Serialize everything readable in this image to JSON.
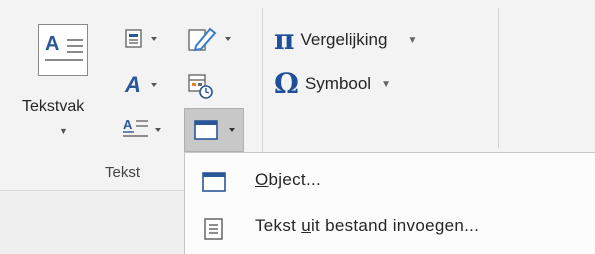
{
  "text_group": {
    "textbox_label": "Tekstvak",
    "group_label": "Tekst"
  },
  "symbols_group": {
    "equation_label": "Vergelijking",
    "symbol_label": "Symbool",
    "pi_glyph": "π",
    "omega_glyph": "Ω"
  },
  "object_menu": {
    "items": [
      {
        "label_pre": "",
        "label_key": "O",
        "label_post": "bject...",
        "icon": "object-window-icon"
      },
      {
        "label_pre": "Tekst ",
        "label_key": "u",
        "label_post": "it bestand invoegen...",
        "icon": "text-file-icon"
      }
    ]
  },
  "colors": {
    "accent_blue": "#2b579a",
    "symbol_blue": "#1f4e9b",
    "pen_blue": "#3a7cc8",
    "date_orange": "#e0822a"
  }
}
